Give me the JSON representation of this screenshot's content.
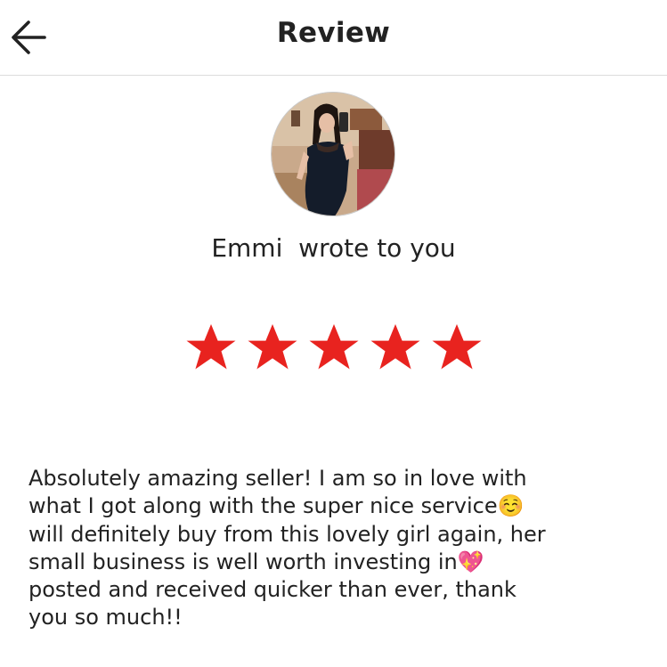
{
  "header": {
    "title": "Review",
    "back_icon": "arrow-left-icon"
  },
  "reviewer": {
    "name": "Emmi",
    "wrote_text": "wrote to you",
    "avatar": "profile-photo"
  },
  "rating": {
    "stars": 5,
    "max": 5,
    "star_icon": "star-icon",
    "color": "#e8231f"
  },
  "review": {
    "lines": [
      "Absolutely amazing seller! I am so in love with",
      "what I got along with the super nice service☺️",
      "will definitely buy from this lovely girl again, her",
      "small business is well worth investing in💖",
      "posted and received quicker than ever, thank",
      "you so much!!"
    ]
  }
}
